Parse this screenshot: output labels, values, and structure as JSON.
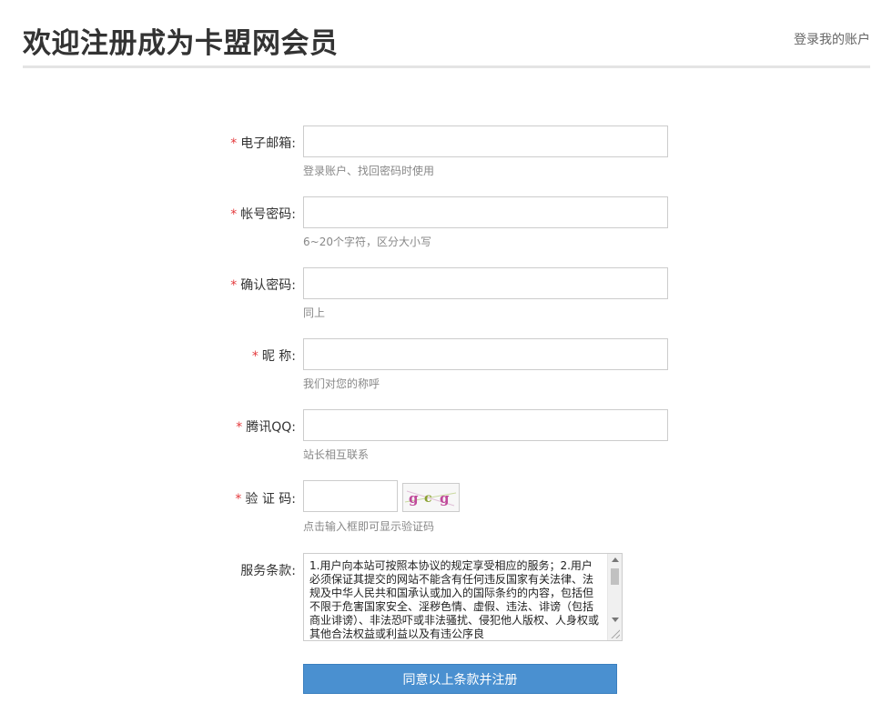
{
  "header": {
    "title": "欢迎注册成为卡盟网会员",
    "login_link": "登录我的账户"
  },
  "form": {
    "required_mark": "*",
    "email": {
      "label": "电子邮箱:",
      "value": "",
      "hint": "登录账户、找回密码时使用"
    },
    "password": {
      "label": "帐号密码:",
      "value": "",
      "hint": "6~20个字符，区分大小写"
    },
    "confirm_password": {
      "label": "确认密码:",
      "value": "",
      "hint": "同上"
    },
    "nickname": {
      "label": "昵 称:",
      "value": "",
      "hint": "我们对您的称呼"
    },
    "qq": {
      "label": "腾讯QQ:",
      "value": "",
      "hint": "站长相互联系"
    },
    "captcha": {
      "label": "验 证 码:",
      "value": "",
      "hint": "点击输入框即可显示验证码",
      "image_text": "gcg"
    },
    "terms": {
      "label": "服务条款:",
      "text": "1.用户向本站可按照本协议的规定享受相应的服务；2.用户必须保证其提交的网站不能含有任何违反国家有关法律、法规及中华人民共和国承认或加入的国际条约的内容，包括但不限于危害国家安全、淫秽色情、虚假、违法、诽谤（包括商业诽谤）、非法恐吓或非法骚扰、侵犯他人版权、人身权或其他合法权益或利益以及有违公序良"
    },
    "submit_label": "同意以上条款并注册"
  },
  "colors": {
    "accent": "#4a90d0",
    "required": "#e4393c"
  }
}
